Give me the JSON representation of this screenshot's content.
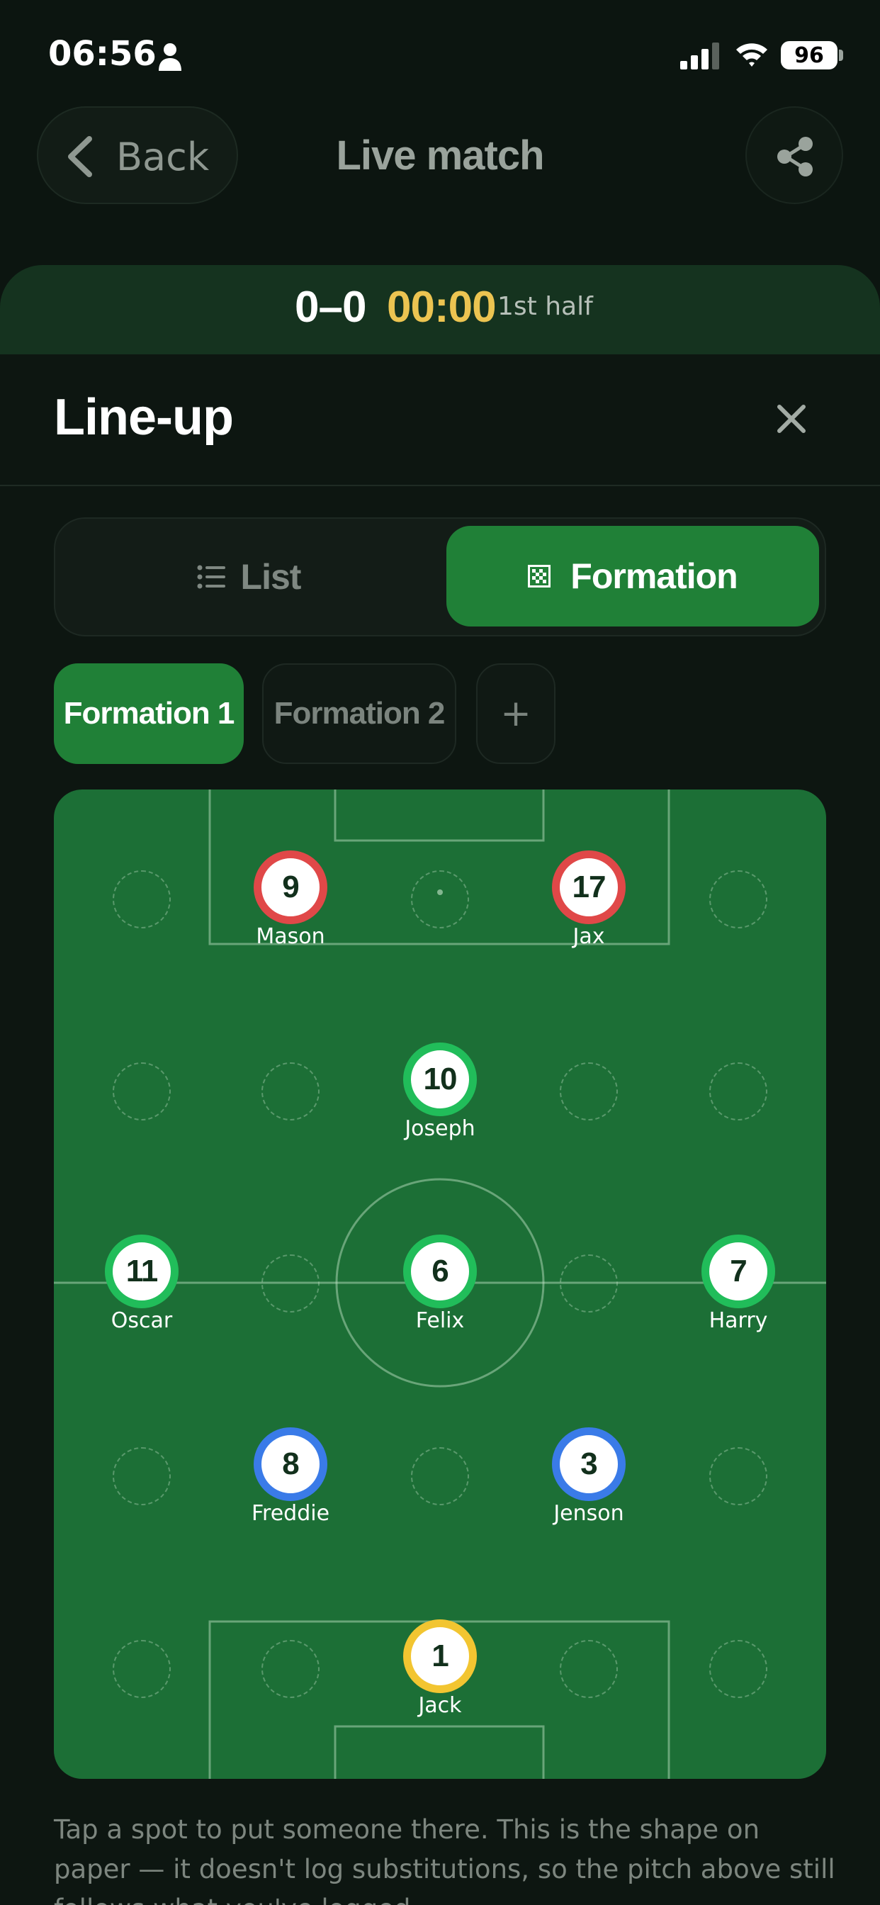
{
  "status_bar": {
    "time": "06:56",
    "battery": "96"
  },
  "nav": {
    "back_label": "Back",
    "title": "Live match"
  },
  "score_bar": {
    "score": "0–0",
    "clock": "00:00",
    "period": "1st half"
  },
  "sheet": {
    "title": "Line-up",
    "view_toggle": {
      "list_label": "List",
      "formation_label": "Formation",
      "selected": "Formation"
    },
    "formation_tabs": [
      "Formation 1",
      "Formation 2"
    ],
    "selected_formation": "Formation 1",
    "add_label": "+"
  },
  "players": [
    {
      "number": "9",
      "name": "Mason",
      "role": "forward",
      "color": "#e04848"
    },
    {
      "number": "17",
      "name": "Jax",
      "role": "forward",
      "color": "#e04848"
    },
    {
      "number": "10",
      "name": "Joseph",
      "role": "midfielder",
      "color": "#21bd5a"
    },
    {
      "number": "11",
      "name": "Oscar",
      "role": "midfielder",
      "color": "#21bd5a"
    },
    {
      "number": "6",
      "name": "Felix",
      "role": "midfielder",
      "color": "#21bd5a"
    },
    {
      "number": "7",
      "name": "Harry",
      "role": "midfielder",
      "color": "#21bd5a"
    },
    {
      "number": "8",
      "name": "Freddie",
      "role": "defender",
      "color": "#3a7be8"
    },
    {
      "number": "3",
      "name": "Jenson",
      "role": "defender",
      "color": "#3a7be8"
    },
    {
      "number": "1",
      "name": "Jack",
      "role": "goalkeeper",
      "color": "#f2c531"
    }
  ],
  "hint": "Tap a spot to put someone there. This is the shape on paper — it doesn't log substitutions, so the pitch above still follows what you've logged.",
  "colors": {
    "accent": "#208037",
    "pitch": "#1c6f36",
    "clock": "#ecc451",
    "background": "#0c1510"
  }
}
